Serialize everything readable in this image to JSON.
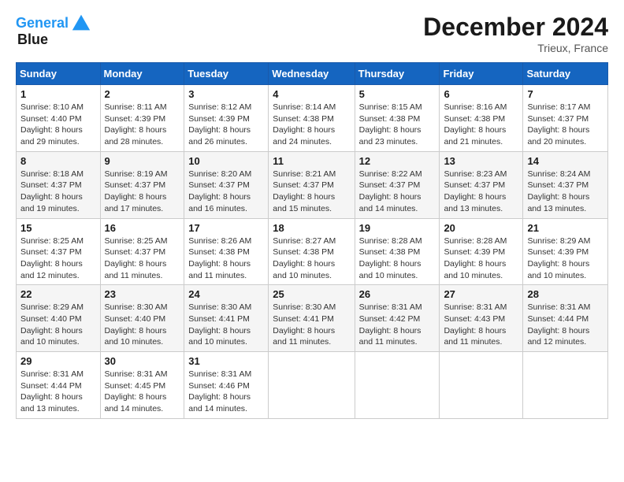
{
  "header": {
    "logo_line1": "General",
    "logo_line2": "Blue",
    "month_title": "December 2024",
    "location": "Trieux, France"
  },
  "days_of_week": [
    "Sunday",
    "Monday",
    "Tuesday",
    "Wednesday",
    "Thursday",
    "Friday",
    "Saturday"
  ],
  "weeks": [
    [
      {
        "day": "1",
        "sunrise": "8:10 AM",
        "sunset": "4:40 PM",
        "daylight": "8 hours and 29 minutes."
      },
      {
        "day": "2",
        "sunrise": "8:11 AM",
        "sunset": "4:39 PM",
        "daylight": "8 hours and 28 minutes."
      },
      {
        "day": "3",
        "sunrise": "8:12 AM",
        "sunset": "4:39 PM",
        "daylight": "8 hours and 26 minutes."
      },
      {
        "day": "4",
        "sunrise": "8:14 AM",
        "sunset": "4:38 PM",
        "daylight": "8 hours and 24 minutes."
      },
      {
        "day": "5",
        "sunrise": "8:15 AM",
        "sunset": "4:38 PM",
        "daylight": "8 hours and 23 minutes."
      },
      {
        "day": "6",
        "sunrise": "8:16 AM",
        "sunset": "4:38 PM",
        "daylight": "8 hours and 21 minutes."
      },
      {
        "day": "7",
        "sunrise": "8:17 AM",
        "sunset": "4:37 PM",
        "daylight": "8 hours and 20 minutes."
      }
    ],
    [
      {
        "day": "8",
        "sunrise": "8:18 AM",
        "sunset": "4:37 PM",
        "daylight": "8 hours and 19 minutes."
      },
      {
        "day": "9",
        "sunrise": "8:19 AM",
        "sunset": "4:37 PM",
        "daylight": "8 hours and 17 minutes."
      },
      {
        "day": "10",
        "sunrise": "8:20 AM",
        "sunset": "4:37 PM",
        "daylight": "8 hours and 16 minutes."
      },
      {
        "day": "11",
        "sunrise": "8:21 AM",
        "sunset": "4:37 PM",
        "daylight": "8 hours and 15 minutes."
      },
      {
        "day": "12",
        "sunrise": "8:22 AM",
        "sunset": "4:37 PM",
        "daylight": "8 hours and 14 minutes."
      },
      {
        "day": "13",
        "sunrise": "8:23 AM",
        "sunset": "4:37 PM",
        "daylight": "8 hours and 13 minutes."
      },
      {
        "day": "14",
        "sunrise": "8:24 AM",
        "sunset": "4:37 PM",
        "daylight": "8 hours and 13 minutes."
      }
    ],
    [
      {
        "day": "15",
        "sunrise": "8:25 AM",
        "sunset": "4:37 PM",
        "daylight": "8 hours and 12 minutes."
      },
      {
        "day": "16",
        "sunrise": "8:25 AM",
        "sunset": "4:37 PM",
        "daylight": "8 hours and 11 minutes."
      },
      {
        "day": "17",
        "sunrise": "8:26 AM",
        "sunset": "4:38 PM",
        "daylight": "8 hours and 11 minutes."
      },
      {
        "day": "18",
        "sunrise": "8:27 AM",
        "sunset": "4:38 PM",
        "daylight": "8 hours and 10 minutes."
      },
      {
        "day": "19",
        "sunrise": "8:28 AM",
        "sunset": "4:38 PM",
        "daylight": "8 hours and 10 minutes."
      },
      {
        "day": "20",
        "sunrise": "8:28 AM",
        "sunset": "4:39 PM",
        "daylight": "8 hours and 10 minutes."
      },
      {
        "day": "21",
        "sunrise": "8:29 AM",
        "sunset": "4:39 PM",
        "daylight": "8 hours and 10 minutes."
      }
    ],
    [
      {
        "day": "22",
        "sunrise": "8:29 AM",
        "sunset": "4:40 PM",
        "daylight": "8 hours and 10 minutes."
      },
      {
        "day": "23",
        "sunrise": "8:30 AM",
        "sunset": "4:40 PM",
        "daylight": "8 hours and 10 minutes."
      },
      {
        "day": "24",
        "sunrise": "8:30 AM",
        "sunset": "4:41 PM",
        "daylight": "8 hours and 10 minutes."
      },
      {
        "day": "25",
        "sunrise": "8:30 AM",
        "sunset": "4:41 PM",
        "daylight": "8 hours and 11 minutes."
      },
      {
        "day": "26",
        "sunrise": "8:31 AM",
        "sunset": "4:42 PM",
        "daylight": "8 hours and 11 minutes."
      },
      {
        "day": "27",
        "sunrise": "8:31 AM",
        "sunset": "4:43 PM",
        "daylight": "8 hours and 11 minutes."
      },
      {
        "day": "28",
        "sunrise": "8:31 AM",
        "sunset": "4:44 PM",
        "daylight": "8 hours and 12 minutes."
      }
    ],
    [
      {
        "day": "29",
        "sunrise": "8:31 AM",
        "sunset": "4:44 PM",
        "daylight": "8 hours and 13 minutes."
      },
      {
        "day": "30",
        "sunrise": "8:31 AM",
        "sunset": "4:45 PM",
        "daylight": "8 hours and 14 minutes."
      },
      {
        "day": "31",
        "sunrise": "8:31 AM",
        "sunset": "4:46 PM",
        "daylight": "8 hours and 14 minutes."
      },
      null,
      null,
      null,
      null
    ]
  ],
  "labels": {
    "sunrise": "Sunrise:",
    "sunset": "Sunset:",
    "daylight": "Daylight:"
  }
}
